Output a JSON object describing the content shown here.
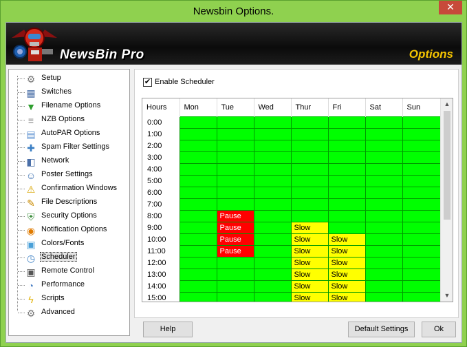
{
  "window": {
    "title": "Newsbin Options.",
    "close_glyph": "✕"
  },
  "banner": {
    "brand": "NewsBin Pro",
    "section": "Options"
  },
  "tree": {
    "items": [
      {
        "label": "Setup",
        "icon": "gear-icon"
      },
      {
        "label": "Switches",
        "icon": "switches-icon"
      },
      {
        "label": "Filename Options",
        "icon": "file-green-icon"
      },
      {
        "label": "NZB Options",
        "icon": "nzb-icon"
      },
      {
        "label": "AutoPAR Options",
        "icon": "par-icon"
      },
      {
        "label": "Spam Filter Settings",
        "icon": "spam-filter-icon"
      },
      {
        "label": "Network",
        "icon": "network-icon"
      },
      {
        "label": "Poster Settings",
        "icon": "poster-icon"
      },
      {
        "label": "Confirmation Windows",
        "icon": "warning-icon"
      },
      {
        "label": "File Descriptions",
        "icon": "file-edit-icon"
      },
      {
        "label": "Security Options",
        "icon": "security-icon"
      },
      {
        "label": "Notification Options",
        "icon": "rss-icon"
      },
      {
        "label": "Colors/Fonts",
        "icon": "colors-icon"
      },
      {
        "label": "Scheduler",
        "icon": "clock-icon"
      },
      {
        "label": "Remote Control",
        "icon": "remote-icon"
      },
      {
        "label": "Performance",
        "icon": "performance-icon"
      },
      {
        "label": "Scripts",
        "icon": "lightning-icon"
      },
      {
        "label": "Advanced",
        "icon": "advanced-gear-icon"
      }
    ],
    "selected": "Scheduler"
  },
  "scheduler": {
    "enable_label": "Enable Scheduler",
    "enabled": true,
    "columns": [
      "Hours",
      "Mon",
      "Tue",
      "Wed",
      "Thur",
      "Fri",
      "Sat",
      "Sun"
    ],
    "rows": [
      {
        "hour": "0:00",
        "cells": [
          "",
          "",
          "",
          "",
          "",
          "",
          ""
        ]
      },
      {
        "hour": "1:00",
        "cells": [
          "",
          "",
          "",
          "",
          "",
          "",
          ""
        ]
      },
      {
        "hour": "2:00",
        "cells": [
          "",
          "",
          "",
          "",
          "",
          "",
          ""
        ]
      },
      {
        "hour": "3:00",
        "cells": [
          "",
          "",
          "",
          "",
          "",
          "",
          ""
        ]
      },
      {
        "hour": "4:00",
        "cells": [
          "",
          "",
          "",
          "",
          "",
          "",
          ""
        ]
      },
      {
        "hour": "5:00",
        "cells": [
          "",
          "",
          "",
          "",
          "",
          "",
          ""
        ]
      },
      {
        "hour": "6:00",
        "cells": [
          "",
          "",
          "",
          "",
          "",
          "",
          ""
        ]
      },
      {
        "hour": "7:00",
        "cells": [
          "",
          "",
          "",
          "",
          "",
          "",
          ""
        ]
      },
      {
        "hour": "8:00",
        "cells": [
          "",
          "Pause",
          "",
          "",
          "",
          "",
          ""
        ]
      },
      {
        "hour": "9:00",
        "cells": [
          "",
          "Pause",
          "",
          "Slow",
          "",
          "",
          ""
        ]
      },
      {
        "hour": "10:00",
        "cells": [
          "",
          "Pause",
          "",
          "Slow",
          "Slow",
          "",
          ""
        ]
      },
      {
        "hour": "11:00",
        "cells": [
          "",
          "Pause",
          "",
          "Slow",
          "Slow",
          "",
          ""
        ]
      },
      {
        "hour": "12:00",
        "cells": [
          "",
          "",
          "",
          "Slow",
          "Slow",
          "",
          ""
        ]
      },
      {
        "hour": "13:00",
        "cells": [
          "",
          "",
          "",
          "Slow",
          "Slow",
          "",
          ""
        ]
      },
      {
        "hour": "14:00",
        "cells": [
          "",
          "",
          "",
          "Slow",
          "Slow",
          "",
          ""
        ]
      },
      {
        "hour": "15:00",
        "cells": [
          "",
          "",
          "",
          "Slow",
          "Slow",
          "",
          ""
        ]
      }
    ],
    "status_colors": {
      "normal": "#00ff00",
      "Pause": "#ff0000",
      "Slow": "#ffff00"
    }
  },
  "buttons": {
    "help": "Help",
    "default_settings": "Default Settings",
    "ok": "Ok"
  }
}
